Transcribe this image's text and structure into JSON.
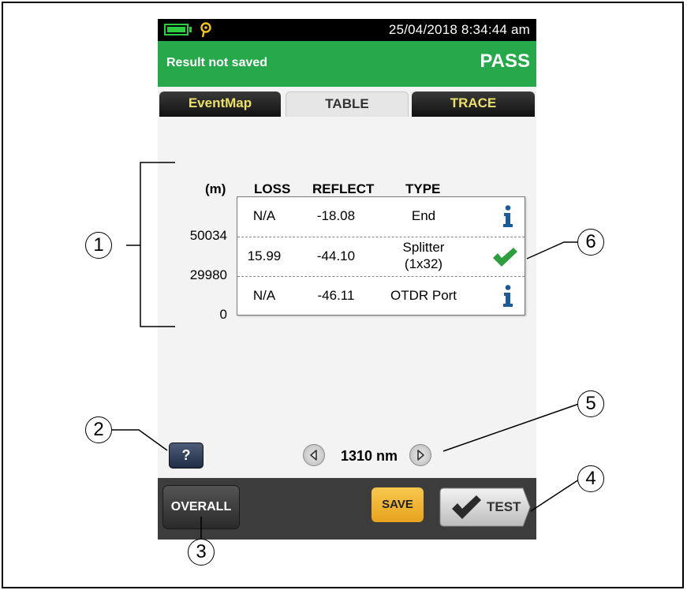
{
  "status_bar": {
    "datetime": "25/04/2018 8:34:44 am",
    "battery_icon": "battery-full-icon",
    "location_icon": "location-pin-icon",
    "battery_color": "#2ecc40"
  },
  "result_bar": {
    "message": "Result not saved",
    "status": "PASS",
    "color": "#27a84a"
  },
  "tabs": [
    {
      "label": "EventMap",
      "active": false
    },
    {
      "label": "TABLE",
      "active": true
    },
    {
      "label": "TRACE",
      "active": false
    }
  ],
  "table": {
    "headers": {
      "distance": "(m)",
      "loss": "LOSS",
      "reflect": "REFLECT",
      "type": "TYPE"
    },
    "rows": [
      {
        "distance": "50034",
        "loss": "N/A",
        "reflect": "-18.08",
        "type": "End",
        "type2": "",
        "icon": "info-icon"
      },
      {
        "distance": "29980",
        "loss": "15.99",
        "reflect": "-44.10",
        "type": "Splitter",
        "type2": "(1x32)",
        "icon": "check-pass-icon"
      },
      {
        "distance": "0",
        "loss": "N/A",
        "reflect": "-46.11",
        "type": "OTDR Port",
        "type2": "",
        "icon": "info-icon"
      }
    ]
  },
  "help_button": {
    "label": "?"
  },
  "wavelength": {
    "label": "1310 nm"
  },
  "bottom_bar": {
    "overall_label": "OVERALL",
    "save_label": "SAVE",
    "test_label": "TEST"
  },
  "callouts": [
    "1",
    "2",
    "3",
    "4",
    "5",
    "6"
  ]
}
